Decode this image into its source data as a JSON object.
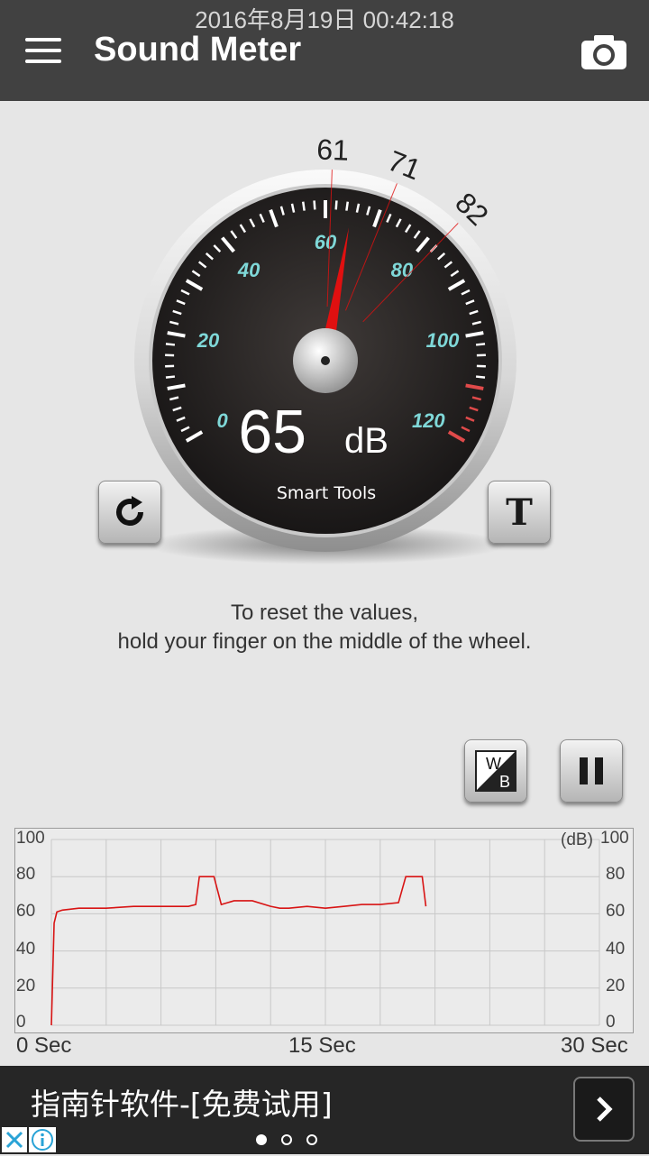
{
  "status_bar": {
    "datetime": "2016年8月19日 00:42:18"
  },
  "app_bar": {
    "title": "Sound Meter",
    "menu_icon": "hamburger-menu-icon",
    "camera_icon": "camera-icon"
  },
  "gauge": {
    "current_db": 65,
    "reading_number": "65",
    "reading_unit": "dB",
    "brand": "Smart Tools",
    "scale_labels": [
      "0",
      "20",
      "40",
      "60",
      "80",
      "100",
      "120"
    ],
    "markers": [
      {
        "label": "61",
        "value": 61
      },
      {
        "label": "71",
        "value": 71
      },
      {
        "label": "82",
        "value": 82
      }
    ],
    "scale_color": "#7fd8d8",
    "needle_color": "#e01010",
    "danger_color": "#e04a4a"
  },
  "buttons": {
    "reset_icon": "refresh-icon",
    "text_icon_glyph": "T",
    "wb_top": "W",
    "wb_bottom": "B",
    "pause_icon": "pause-icon"
  },
  "hint": {
    "line1": "To reset the values,",
    "line2": "hold your finger on the middle of the wheel."
  },
  "chart_data": {
    "type": "line",
    "unit_label": "(dB)",
    "y_ticks_left": [
      "100",
      "80",
      "60",
      "40",
      "20",
      "0"
    ],
    "y_ticks_right": [
      "100",
      "80",
      "60",
      "40",
      "20",
      "0"
    ],
    "x_labels": [
      "0 Sec",
      "15 Sec",
      "30 Sec"
    ],
    "xlim": [
      0,
      30
    ],
    "ylim": [
      0,
      100
    ],
    "grid": true,
    "line_color": "#d81414",
    "series": [
      {
        "x": [
          0,
          0.15,
          0.3,
          0.6,
          1.5,
          3,
          4.5,
          6,
          7.5,
          7.9,
          8.1,
          8.5,
          8.9,
          9.3,
          10,
          11,
          12,
          12.5,
          13,
          14,
          15,
          16,
          17,
          18,
          19,
          19.4,
          19.6,
          20.3,
          20.5
        ],
        "y": [
          0,
          55,
          61,
          62,
          63,
          63,
          64,
          64,
          64,
          65,
          80,
          80,
          80,
          65,
          67,
          67,
          64,
          63,
          63,
          64,
          63,
          64,
          65,
          65,
          66,
          80,
          80,
          80,
          64
        ]
      }
    ]
  },
  "ad": {
    "text": "指南针软件-[免费试用]",
    "arrow_icon": "chevron-right-icon",
    "close_icon": "close-icon",
    "info_icon": "info-icon"
  },
  "pager": {
    "active_index": 0,
    "count": 3
  }
}
